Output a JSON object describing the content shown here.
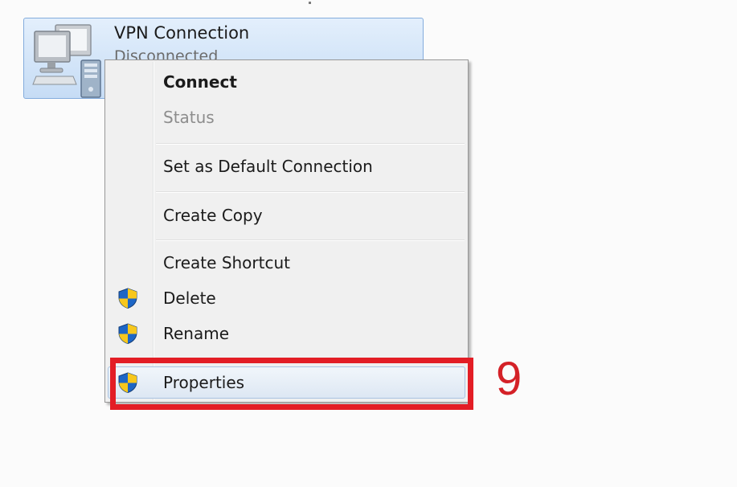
{
  "connection": {
    "name": "VPN Connection",
    "status": "Disconnected",
    "icon": "network-computer-icon"
  },
  "context_menu": {
    "items": [
      {
        "label": "Connect",
        "bold": true,
        "enabled": true,
        "icon": null
      },
      {
        "label": "Status",
        "bold": false,
        "enabled": false,
        "icon": null
      },
      {
        "label": "Set as Default Connection",
        "bold": false,
        "enabled": true,
        "icon": null
      },
      {
        "label": "Create Copy",
        "bold": false,
        "enabled": true,
        "icon": null
      },
      {
        "label": "Create Shortcut",
        "bold": false,
        "enabled": true,
        "icon": null
      },
      {
        "label": "Delete",
        "bold": false,
        "enabled": true,
        "icon": "uac-shield-icon"
      },
      {
        "label": "Rename",
        "bold": false,
        "enabled": true,
        "icon": "uac-shield-icon"
      },
      {
        "label": "Properties",
        "bold": false,
        "enabled": true,
        "icon": "uac-shield-icon",
        "highlighted": true
      }
    ]
  },
  "annotation": {
    "step_number": "9",
    "color": "#e31d25"
  }
}
